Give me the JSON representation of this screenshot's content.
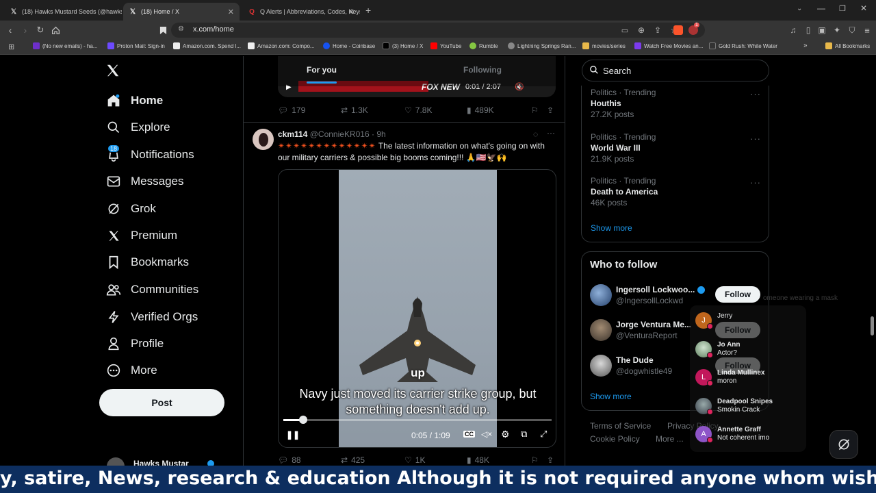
{
  "browser": {
    "tabs": [
      {
        "title": "(18) Hawks Mustard Seeds (@hawksmu",
        "icon": "x-logo-icon"
      },
      {
        "title": "(18) Home / X",
        "icon": "x-logo-icon"
      },
      {
        "title": "Q Alerts | Abbreviations, Codes, Keys & :",
        "icon": "q-icon"
      }
    ],
    "url": "x.com/home",
    "bookmarks": [
      "(No new emails) - ha...",
      "Proton Mail: Sign-in",
      "Amazon.com. Spend l...",
      "Amazon.com: Compo...",
      "Home - Coinbase",
      "(3) Home / X",
      "YouTube",
      "Rumble",
      "Lightning Springs Ran...",
      "movies/series",
      "Watch Free Movies an...",
      "Gold Rush: White Water"
    ],
    "all_bookmarks": "All Bookmarks",
    "extension_badge": "1"
  },
  "sidebar": {
    "items": [
      {
        "label": "Home",
        "icon": "home-icon"
      },
      {
        "label": "Explore",
        "icon": "search-icon"
      },
      {
        "label": "Notifications",
        "icon": "bell-icon",
        "badge": "18"
      },
      {
        "label": "Messages",
        "icon": "mail-icon"
      },
      {
        "label": "Grok",
        "icon": "grok-icon"
      },
      {
        "label": "Premium",
        "icon": "x-logo-icon"
      },
      {
        "label": "Bookmarks",
        "icon": "bookmark-icon"
      },
      {
        "label": "Communities",
        "icon": "people-icon"
      },
      {
        "label": "Verified Orgs",
        "icon": "lightning-icon"
      },
      {
        "label": "Profile",
        "icon": "person-icon"
      },
      {
        "label": "More",
        "icon": "more-circle-icon"
      }
    ],
    "post_label": "Post",
    "account_name": "Hawks Mustar"
  },
  "timeline": {
    "tabs": [
      "For you",
      "Following"
    ],
    "prev_video_time": "0:01 / 2:07",
    "prev_video_overlay": "FOX NEW",
    "prev_stats": {
      "replies": "179",
      "reposts": "1.3K",
      "likes": "7.8K",
      "views": "489K"
    },
    "tweet": {
      "name": "ckm114",
      "handle": "@ConnieKR016",
      "time": "· 9h",
      "text": "The latest information on what's going on with our military carriers & possible big booms coming!!! 🙏🇺🇸🦅🙌",
      "video": {
        "word": "up",
        "caption_line1": "Navy just moved its carrier strike group, but",
        "caption_line2": "something doesn't add up.",
        "time": "0:05 / 1:09",
        "progress": 0.075
      },
      "stats": {
        "replies": "88",
        "reposts": "425",
        "likes": "1K",
        "views": "48K"
      }
    }
  },
  "right": {
    "search_placeholder": "Search",
    "trends": [
      {
        "category": "Politics · Trending",
        "name": "Houthis",
        "posts": "27.2K posts"
      },
      {
        "category": "Politics · Trending",
        "name": "World War III",
        "posts": "21.9K posts"
      },
      {
        "category": "Politics · Trending",
        "name": "Death to America",
        "posts": "46K posts"
      }
    ],
    "show_more": "Show more",
    "who_to_follow_title": "Who to follow",
    "who_to_follow": [
      {
        "name": "Ingersoll Lockwoo...",
        "handle": "@IngersollLockwd"
      },
      {
        "name": "Jorge Ventura Me...",
        "handle": "@VenturaReport"
      },
      {
        "name": "The Dude",
        "handle": "@dogwhistle49"
      }
    ],
    "follow_label": "Follow",
    "show_more_2": "Show more",
    "footer": [
      "Terms of Service",
      "Privacy Policy",
      "Cookie Policy",
      "More ..."
    ],
    "hover_text": "omeone wearing a mask"
  },
  "overlay_notifications": [
    {
      "name": "Jerry",
      "text": "",
      "initial": "J",
      "color": "#c0661d"
    },
    {
      "name": "Jo Ann",
      "text": "Actor?",
      "initial": "",
      "color": "#6a8f6b"
    },
    {
      "name": "Linda Mullinex",
      "text": "moron",
      "initial": "L",
      "color": "#c2185b"
    },
    {
      "name": "Deadpool Snipes",
      "text": "Smokin Crack",
      "initial": "",
      "color": "#444b5a"
    },
    {
      "name": "Annette Graff",
      "text": "Not coherent imo",
      "initial": "A",
      "color": "#8e55c8"
    }
  ],
  "ticker": "y, satire, News, research & education Although it is not required anyone whom wishes to Donate c"
}
